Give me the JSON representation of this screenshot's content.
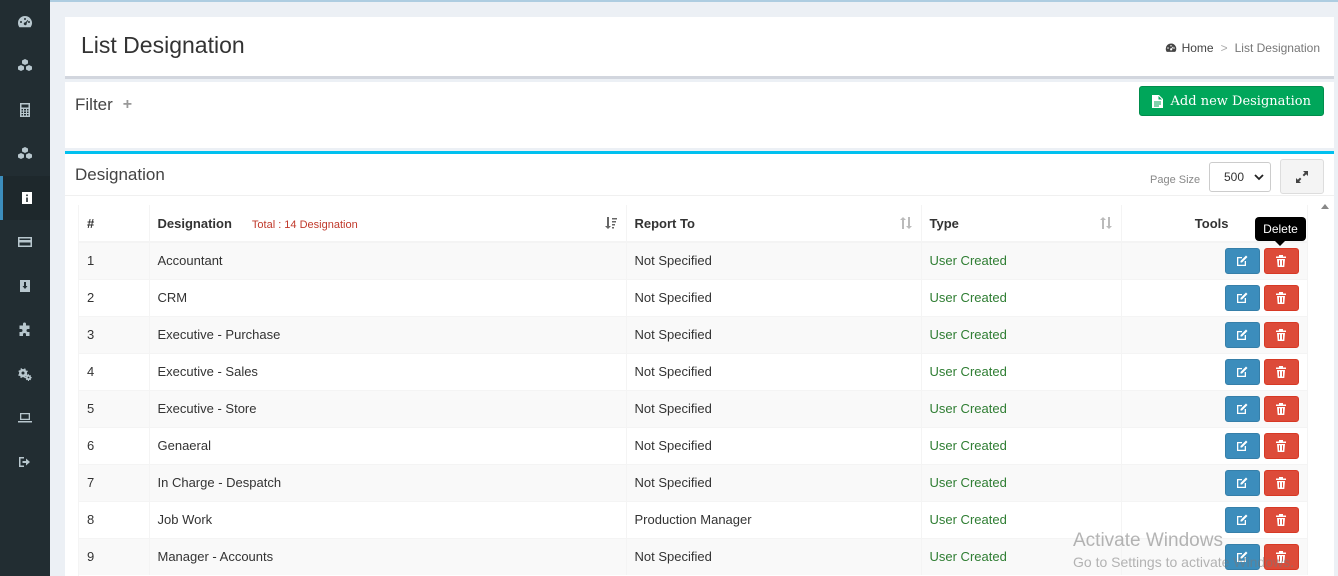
{
  "sidebar": {
    "items": [
      {
        "icon": "dashboard-icon"
      },
      {
        "icon": "cubes-icon"
      },
      {
        "icon": "calculator-icon"
      },
      {
        "icon": "cubes-icon"
      },
      {
        "icon": "designation-icon",
        "active": true
      },
      {
        "icon": "credit-card-icon"
      },
      {
        "icon": "archive-icon"
      },
      {
        "icon": "puzzle-icon"
      },
      {
        "icon": "cogs-icon"
      },
      {
        "icon": "laptop-icon"
      },
      {
        "icon": "sign-out-icon"
      }
    ]
  },
  "header": {
    "title": "List Designation",
    "breadcrumb": {
      "home": "Home",
      "separator": ">",
      "current": "List Designation"
    }
  },
  "filter": {
    "title": "Filter",
    "toggle": "+"
  },
  "toolbar": {
    "add_label": "Add new Designation"
  },
  "designation_box": {
    "title": "Designation",
    "page_size_label": "Page Size",
    "page_size_value": "500"
  },
  "table": {
    "columns": {
      "num": "#",
      "designation": "Designation",
      "total": "Total : 14 Designation",
      "report_to": "Report To",
      "type": "Type",
      "tools": "Tools"
    },
    "rows": [
      {
        "num": "1",
        "designation": "Accountant",
        "report_to": "Not Specified",
        "type": "User Created"
      },
      {
        "num": "2",
        "designation": "CRM",
        "report_to": "Not Specified",
        "type": "User Created"
      },
      {
        "num": "3",
        "designation": "Executive - Purchase",
        "report_to": "Not Specified",
        "type": "User Created"
      },
      {
        "num": "4",
        "designation": "Executive - Sales",
        "report_to": "Not Specified",
        "type": "User Created"
      },
      {
        "num": "5",
        "designation": "Executive - Store",
        "report_to": "Not Specified",
        "type": "User Created"
      },
      {
        "num": "6",
        "designation": "Genaeral",
        "report_to": "Not Specified",
        "type": "User Created"
      },
      {
        "num": "7",
        "designation": "In Charge - Despatch",
        "report_to": "Not Specified",
        "type": "User Created"
      },
      {
        "num": "8",
        "designation": "Job Work",
        "report_to": "Production Manager",
        "type": "User Created"
      },
      {
        "num": "9",
        "designation": "Manager - Accounts",
        "report_to": "Not Specified",
        "type": "User Created"
      }
    ]
  },
  "tooltip": {
    "text": "Delete"
  },
  "watermark": {
    "title": "Activate Windows",
    "subtitle": "Go to Settings to activate Windows."
  },
  "colors": {
    "sidebar_bg": "#222d32",
    "primary": "#3c8dbc",
    "success": "#00a65a",
    "danger": "#dd4b39",
    "info_border": "#00c0ef",
    "type_text": "#2e7d32",
    "total_text": "#c0392b"
  }
}
